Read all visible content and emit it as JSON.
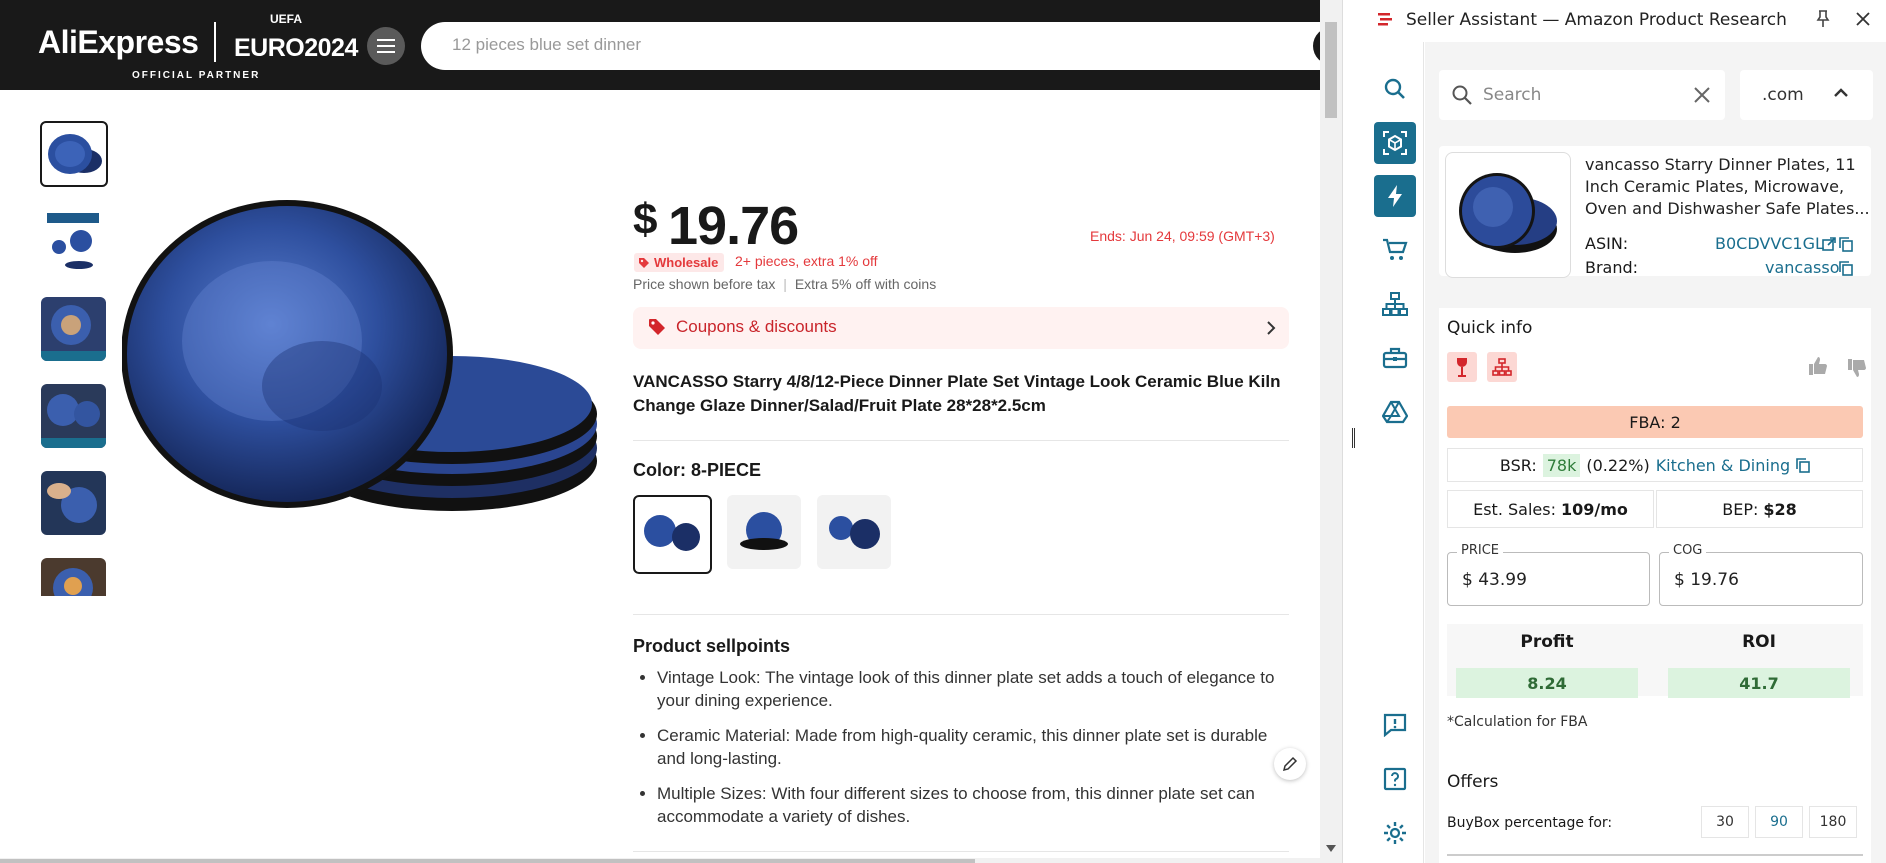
{
  "aliexpress": {
    "logo": "AliExpress",
    "euro": "EURO2024",
    "uefa": "UEFA",
    "partner": "OFFICIAL PARTNER",
    "search_placeholder": "12 pieces blue set dinner",
    "price_currency": "$",
    "price_value": "19.76",
    "ends": "Ends: Jun 24, 09:59 (GMT+3)",
    "wholesale_badge": "Wholesale",
    "wholesale_desc": "2+ pieces, extra 1% off",
    "tax_note": "Price shown before tax",
    "coins_note": "Extra 5% off with coins",
    "coupons": "Coupons & discounts",
    "title": "VANCASSO Starry 4/8/12-Piece Dinner Plate Set Vintage Look Ceramic Blue Kiln Change Glaze Dinner/Salad/Fruit Plate 28*28*2.5cm",
    "color_label": "Color: 8-PIECE",
    "sellpoints_title": "Product sellpoints",
    "sellpoints": [
      "Vintage Look: The vintage look of this dinner plate set adds a touch of elegance to your dining experience.",
      "Ceramic Material: Made from high-quality ceramic, this dinner plate set is durable and long-lasting.",
      "Multiple Sizes: With four different sizes to choose from, this dinner plate set can accommodate a variety of dishes."
    ]
  },
  "seller_assistant": {
    "title": "Seller Assistant — Amazon Product Research",
    "search_placeholder": "Search",
    "marketplace": ".com",
    "product": {
      "name": "vancasso Starry Dinner Plates, 11 Inch Ceramic Plates, Microwave, Oven and Dishwasher Safe Plates...",
      "asin_label": "ASIN:",
      "asin": "B0CDVVC1GL",
      "brand_label": "Brand:",
      "brand": "vancasso"
    },
    "quick_info": {
      "title": "Quick info",
      "fba": "FBA: 2",
      "bsr_label": "BSR:",
      "bsr_value": "78k",
      "bsr_pct": "(0.22%)",
      "bsr_category": "Kitchen & Dining",
      "est_sales_label": "Est. Sales:",
      "est_sales_value": "109/mo",
      "bep_label": "BEP:",
      "bep_value": "$28",
      "price_label": "PRICE",
      "price_value": "$ 43.99",
      "cog_label": "COG",
      "cog_value": "$ 19.76",
      "profit_label": "Profit",
      "profit_value": "8.24",
      "roi_label": "ROI",
      "roi_value": "41.7",
      "calc_note": "*Calculation for FBA"
    },
    "offers": {
      "title": "Offers",
      "buybox_label": "BuyBox percentage for:",
      "periods": [
        "30",
        "90",
        "180"
      ]
    }
  },
  "colors": {
    "accent_teal": "#1a6e8e",
    "aliexpress_red": "#e4393c",
    "fba_bg": "#fbc9b3",
    "green_bg": "#dcf3df"
  }
}
